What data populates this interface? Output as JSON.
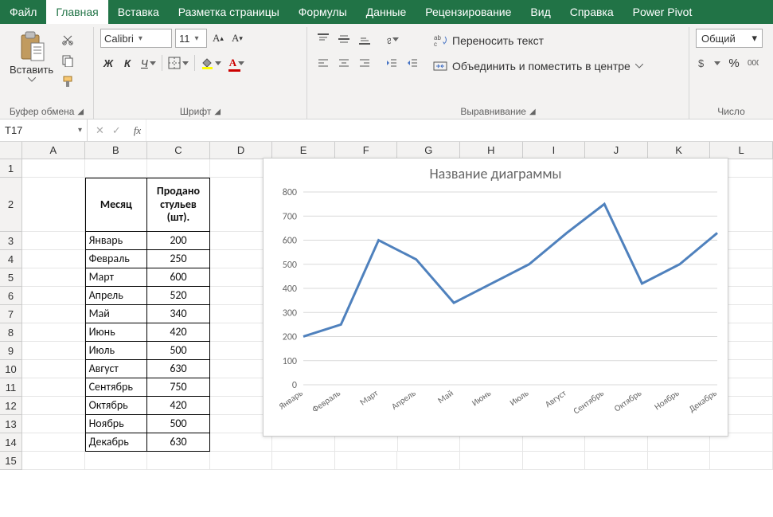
{
  "menu": {
    "tabs": [
      "Файл",
      "Главная",
      "Вставка",
      "Разметка страницы",
      "Формулы",
      "Данные",
      "Рецензирование",
      "Вид",
      "Справка",
      "Power Pivot"
    ],
    "active_index": 1
  },
  "ribbon": {
    "clipboard": {
      "paste": "Вставить",
      "group_label": "Буфер обмена"
    },
    "font": {
      "family": "Calibri",
      "size": "11",
      "bold": "Ж",
      "italic": "К",
      "underline": "Ч",
      "group_label": "Шрифт"
    },
    "alignment": {
      "wrap": "Переносить текст",
      "merge": "Объединить и поместить в центре",
      "group_label": "Выравнивание"
    },
    "number": {
      "format": "Общий",
      "group_label": "Число"
    }
  },
  "fbar": {
    "namebox": "T17",
    "fx": "fx",
    "value": ""
  },
  "grid": {
    "cols": [
      "A",
      "B",
      "C",
      "D",
      "E",
      "F",
      "G",
      "H",
      "I",
      "J",
      "K",
      "L"
    ],
    "rows": [
      "1",
      "2",
      "3",
      "4",
      "5",
      "6",
      "7",
      "8",
      "9",
      "10",
      "11",
      "12",
      "13",
      "14",
      "15"
    ],
    "header": {
      "b": "Месяц",
      "c": "Продано стульев (шт)."
    }
  },
  "chart_data": {
    "type": "line",
    "title": "Название диаграммы",
    "xlabel": "",
    "ylabel": "",
    "ylim": [
      0,
      800
    ],
    "yticks": [
      0,
      100,
      200,
      300,
      400,
      500,
      600,
      700,
      800
    ],
    "categories": [
      "Январь",
      "Февраль",
      "Март",
      "Апрель",
      "Май",
      "Июнь",
      "Июль",
      "Август",
      "Сентябрь",
      "Октябрь",
      "Ноябрь",
      "Декабрь"
    ],
    "values": [
      200,
      250,
      600,
      520,
      340,
      420,
      500,
      630,
      750,
      420,
      500,
      630
    ],
    "line_color": "#4f81bd"
  }
}
